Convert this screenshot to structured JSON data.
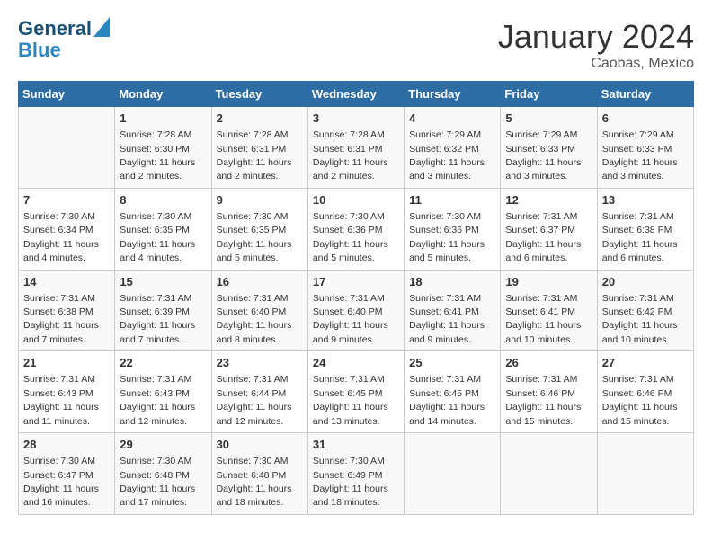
{
  "logo": {
    "line1": "General",
    "line2": "Blue"
  },
  "title": "January 2024",
  "location": "Caobas, Mexico",
  "days_of_week": [
    "Sunday",
    "Monday",
    "Tuesday",
    "Wednesday",
    "Thursday",
    "Friday",
    "Saturday"
  ],
  "weeks": [
    [
      {
        "day": "",
        "info": ""
      },
      {
        "day": "1",
        "info": "Sunrise: 7:28 AM\nSunset: 6:30 PM\nDaylight: 11 hours and 2 minutes."
      },
      {
        "day": "2",
        "info": "Sunrise: 7:28 AM\nSunset: 6:31 PM\nDaylight: 11 hours and 2 minutes."
      },
      {
        "day": "3",
        "info": "Sunrise: 7:28 AM\nSunset: 6:31 PM\nDaylight: 11 hours and 2 minutes."
      },
      {
        "day": "4",
        "info": "Sunrise: 7:29 AM\nSunset: 6:32 PM\nDaylight: 11 hours and 3 minutes."
      },
      {
        "day": "5",
        "info": "Sunrise: 7:29 AM\nSunset: 6:33 PM\nDaylight: 11 hours and 3 minutes."
      },
      {
        "day": "6",
        "info": "Sunrise: 7:29 AM\nSunset: 6:33 PM\nDaylight: 11 hours and 3 minutes."
      }
    ],
    [
      {
        "day": "7",
        "info": "Sunrise: 7:30 AM\nSunset: 6:34 PM\nDaylight: 11 hours and 4 minutes."
      },
      {
        "day": "8",
        "info": "Sunrise: 7:30 AM\nSunset: 6:35 PM\nDaylight: 11 hours and 4 minutes."
      },
      {
        "day": "9",
        "info": "Sunrise: 7:30 AM\nSunset: 6:35 PM\nDaylight: 11 hours and 5 minutes."
      },
      {
        "day": "10",
        "info": "Sunrise: 7:30 AM\nSunset: 6:36 PM\nDaylight: 11 hours and 5 minutes."
      },
      {
        "day": "11",
        "info": "Sunrise: 7:30 AM\nSunset: 6:36 PM\nDaylight: 11 hours and 5 minutes."
      },
      {
        "day": "12",
        "info": "Sunrise: 7:31 AM\nSunset: 6:37 PM\nDaylight: 11 hours and 6 minutes."
      },
      {
        "day": "13",
        "info": "Sunrise: 7:31 AM\nSunset: 6:38 PM\nDaylight: 11 hours and 6 minutes."
      }
    ],
    [
      {
        "day": "14",
        "info": "Sunrise: 7:31 AM\nSunset: 6:38 PM\nDaylight: 11 hours and 7 minutes."
      },
      {
        "day": "15",
        "info": "Sunrise: 7:31 AM\nSunset: 6:39 PM\nDaylight: 11 hours and 7 minutes."
      },
      {
        "day": "16",
        "info": "Sunrise: 7:31 AM\nSunset: 6:40 PM\nDaylight: 11 hours and 8 minutes."
      },
      {
        "day": "17",
        "info": "Sunrise: 7:31 AM\nSunset: 6:40 PM\nDaylight: 11 hours and 9 minutes."
      },
      {
        "day": "18",
        "info": "Sunrise: 7:31 AM\nSunset: 6:41 PM\nDaylight: 11 hours and 9 minutes."
      },
      {
        "day": "19",
        "info": "Sunrise: 7:31 AM\nSunset: 6:41 PM\nDaylight: 11 hours and 10 minutes."
      },
      {
        "day": "20",
        "info": "Sunrise: 7:31 AM\nSunset: 6:42 PM\nDaylight: 11 hours and 10 minutes."
      }
    ],
    [
      {
        "day": "21",
        "info": "Sunrise: 7:31 AM\nSunset: 6:43 PM\nDaylight: 11 hours and 11 minutes."
      },
      {
        "day": "22",
        "info": "Sunrise: 7:31 AM\nSunset: 6:43 PM\nDaylight: 11 hours and 12 minutes."
      },
      {
        "day": "23",
        "info": "Sunrise: 7:31 AM\nSunset: 6:44 PM\nDaylight: 11 hours and 12 minutes."
      },
      {
        "day": "24",
        "info": "Sunrise: 7:31 AM\nSunset: 6:45 PM\nDaylight: 11 hours and 13 minutes."
      },
      {
        "day": "25",
        "info": "Sunrise: 7:31 AM\nSunset: 6:45 PM\nDaylight: 11 hours and 14 minutes."
      },
      {
        "day": "26",
        "info": "Sunrise: 7:31 AM\nSunset: 6:46 PM\nDaylight: 11 hours and 15 minutes."
      },
      {
        "day": "27",
        "info": "Sunrise: 7:31 AM\nSunset: 6:46 PM\nDaylight: 11 hours and 15 minutes."
      }
    ],
    [
      {
        "day": "28",
        "info": "Sunrise: 7:30 AM\nSunset: 6:47 PM\nDaylight: 11 hours and 16 minutes."
      },
      {
        "day": "29",
        "info": "Sunrise: 7:30 AM\nSunset: 6:48 PM\nDaylight: 11 hours and 17 minutes."
      },
      {
        "day": "30",
        "info": "Sunrise: 7:30 AM\nSunset: 6:48 PM\nDaylight: 11 hours and 18 minutes."
      },
      {
        "day": "31",
        "info": "Sunrise: 7:30 AM\nSunset: 6:49 PM\nDaylight: 11 hours and 18 minutes."
      },
      {
        "day": "",
        "info": ""
      },
      {
        "day": "",
        "info": ""
      },
      {
        "day": "",
        "info": ""
      }
    ]
  ]
}
